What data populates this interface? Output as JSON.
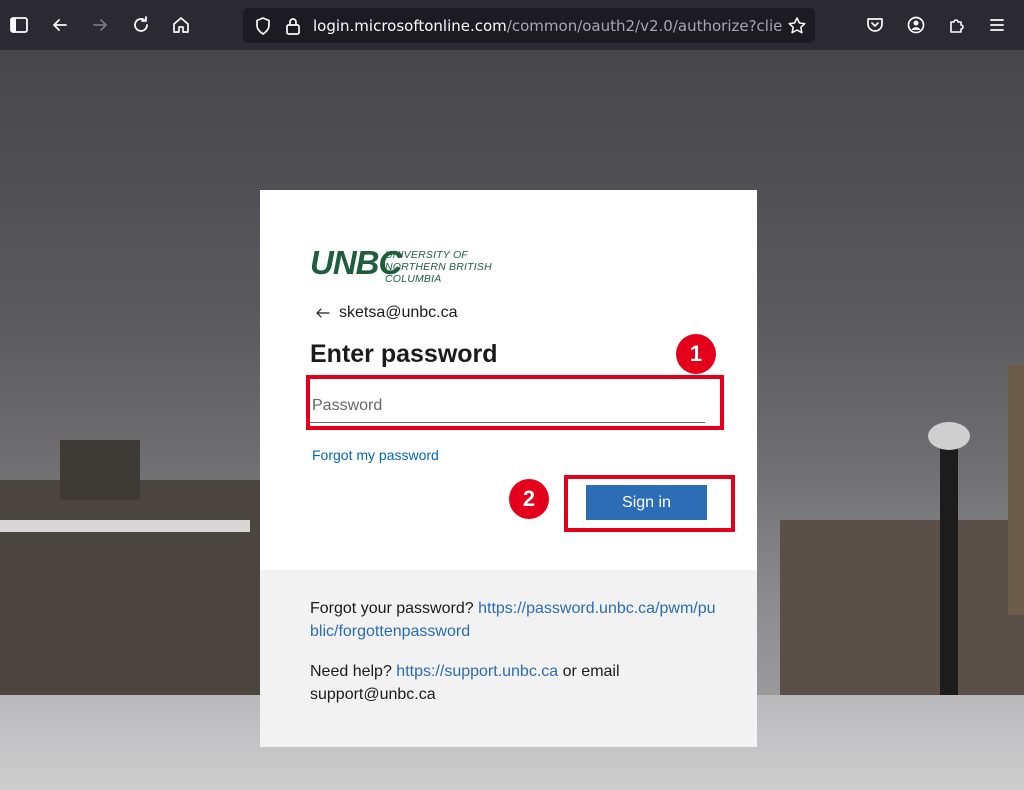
{
  "browser": {
    "url_host": "login.microsoftonline.com",
    "url_path": "/common/oauth2/v2.0/authorize?client_",
    "icons": [
      "sidebar-icon",
      "back-icon",
      "forward-icon",
      "reload-icon",
      "home-icon",
      "shield-icon",
      "lock-icon",
      "bookmark-star-icon",
      "pocket-icon",
      "account-icon",
      "extensions-icon",
      "menu-icon"
    ]
  },
  "login": {
    "logo_mark": "UNBC",
    "logo_line1": "UNIVERSITY OF",
    "logo_line2": "NORTHERN BRITISH COLUMBIA",
    "email": "sketsa@unbc.ca",
    "title": "Enter password",
    "password_placeholder": "Password",
    "forgot_link": "Forgot my password",
    "signin_label": "Sign in"
  },
  "footer": {
    "forgot_prefix": "Forgot your password?",
    "forgot_url": "https://password.unbc.ca/pwm/public/forgottenpassword",
    "help_prefix": "Need help?",
    "help_url": "https://support.unbc.ca",
    "help_middle": "or email",
    "help_email": "support@unbc.ca"
  },
  "annotations": {
    "badge_1": "1",
    "badge_2": "2",
    "color": "#e4001b"
  },
  "colors": {
    "brand_green": "#1e5e3e",
    "primary_button": "#2c6db5",
    "link": "#0067b8"
  }
}
